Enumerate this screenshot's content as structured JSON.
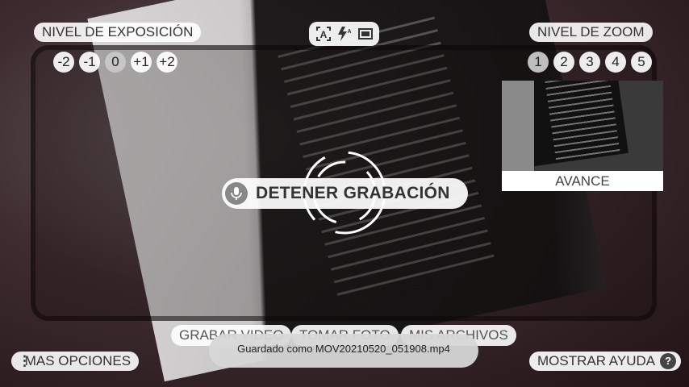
{
  "exposure": {
    "title": "NIVEL DE EXPOSICIÓN",
    "levels": [
      "-2",
      "-1",
      "0",
      "+1",
      "+2"
    ],
    "selected": "0"
  },
  "zoom": {
    "title": "NIVEL DE ZOOM",
    "levels": [
      "1",
      "2",
      "3",
      "4",
      "5"
    ],
    "selected": "1"
  },
  "toolbar": {
    "icons": [
      "auto-exposure-icon",
      "flash-auto-icon",
      "aspect-ratio-icon"
    ],
    "auto_label": "A"
  },
  "preview": {
    "label": "AVANCE"
  },
  "recording": {
    "stop_label": "DETENER GRABACIÓN"
  },
  "bottom_tabs": [
    "GRABAR VIDEO",
    "TOMAR FOTO",
    "MIS ARCHIVOS"
  ],
  "more_options": {
    "label": "MAS OPCIONES"
  },
  "help": {
    "label": "MOSTRAR AYUDA",
    "icon_text": "?"
  },
  "toast": {
    "message": "Guardado como MOV20210520_051908.mp4"
  },
  "colors": {
    "overlay": "#ffffff",
    "accent_dark": "#444444"
  }
}
